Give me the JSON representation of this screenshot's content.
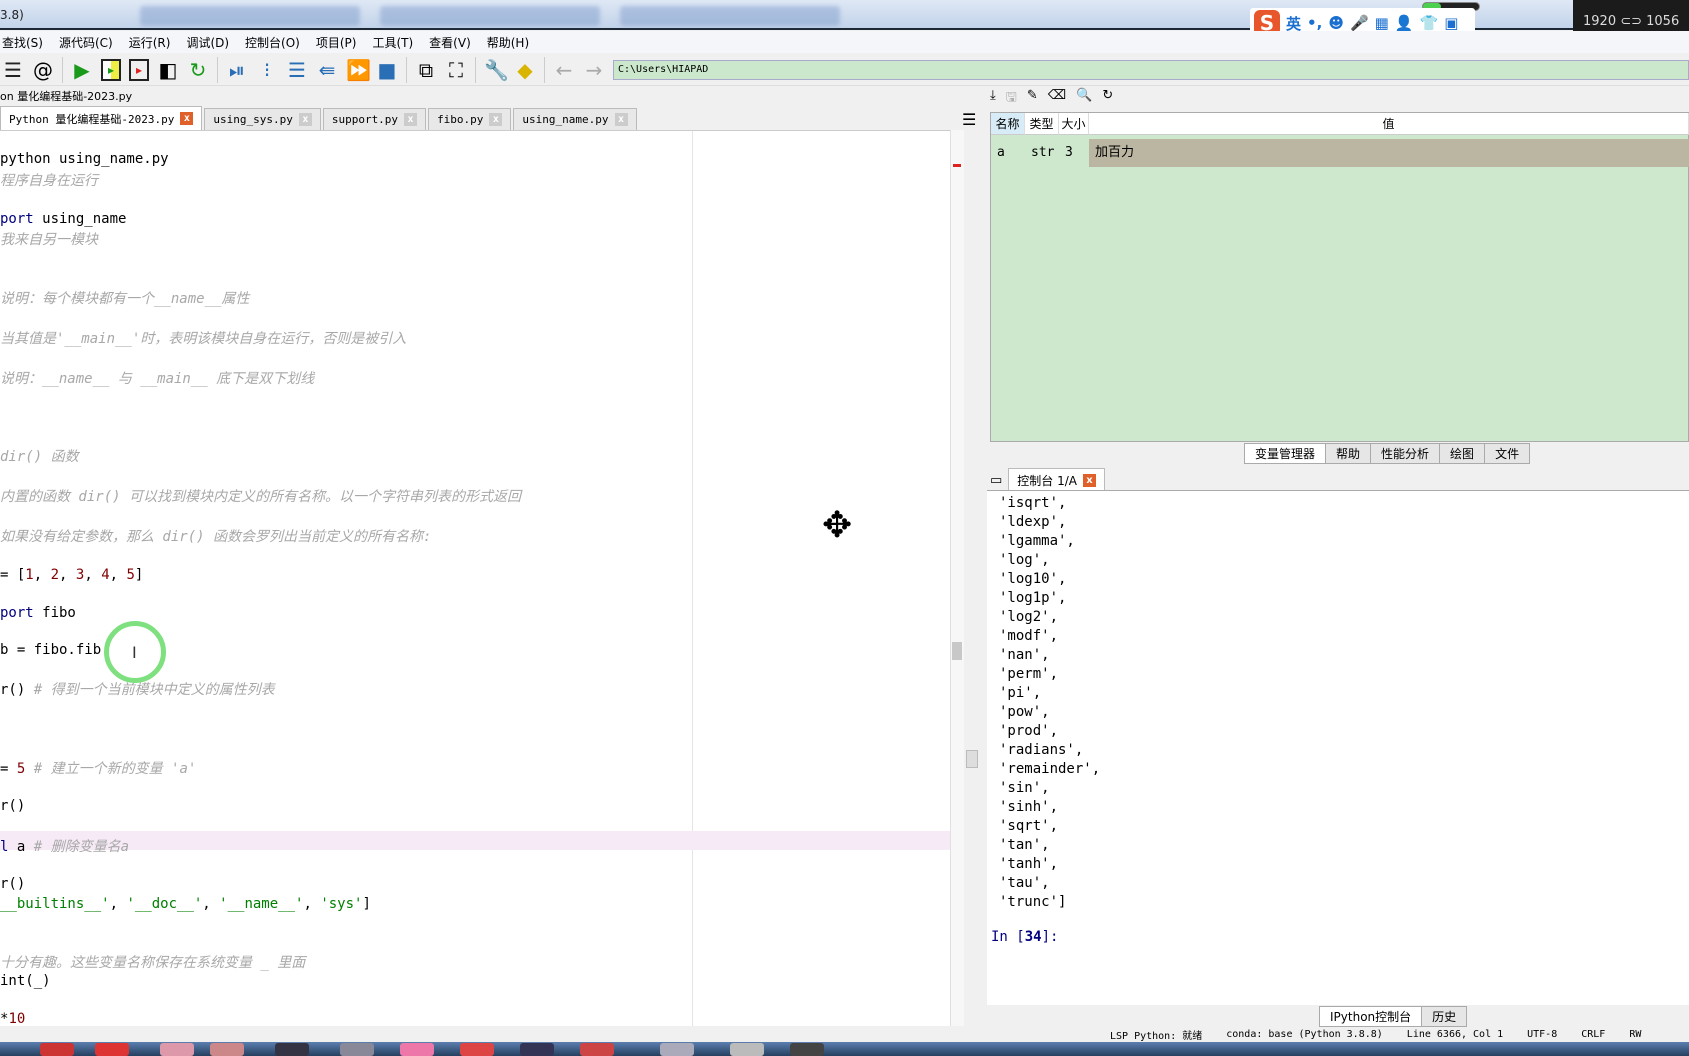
{
  "window": {
    "title": "3.8)"
  },
  "ime": {
    "logo": "S",
    "items": [
      "英",
      "•,",
      "☻",
      "🎤",
      "▦",
      "👤",
      "👕",
      "▣"
    ]
  },
  "screen_resolution": "1920 ⊂⊃ 1056",
  "menu": [
    "查找(S)",
    "源代码(C)",
    "运行(R)",
    "调试(D)",
    "控制台(O)",
    "项目(P)",
    "工具(T)",
    "查看(V)",
    "帮助(H)"
  ],
  "toolbar": {
    "icons": [
      "list-icon",
      "at-icon",
      "run-icon",
      "run-cell-icon",
      "run-cell-advance-icon",
      "run-selection-icon",
      "rerun-icon",
      "debug-icon",
      "step-icon",
      "step-into-icon",
      "step-return-icon",
      "continue-icon",
      "stop-icon",
      "maximize-pane-icon",
      "fullscreen-icon",
      "wrench-icon",
      "python-path-icon",
      "back-icon",
      "forward-icon"
    ],
    "path": "C:\\Users\\HIAPAD"
  },
  "file_label": "on 量化编程基础-2023.py",
  "tabs": [
    {
      "label": "Python 量化编程基础-2023.py",
      "active": true
    },
    {
      "label": "using_sys.py"
    },
    {
      "label": "support.py"
    },
    {
      "label": "fibo.py"
    },
    {
      "label": "using_name.py"
    }
  ],
  "editor": {
    "lines": [
      [
        [
          "python using_name.py",
          ""
        ]
      ],
      [
        [
          "程序自身在运行",
          "cm"
        ]
      ],
      [
        [
          "port",
          "kw"
        ],
        [
          " using_name",
          ""
        ]
      ],
      [
        [
          "我来自另一模块",
          "cm"
        ]
      ],
      [
        [
          "说明：每个模块都有一个__name__属性",
          "cm"
        ]
      ],
      [
        [
          "当其值是'__main__'时，表明该模块自身在运行，否则是被引入",
          "cm"
        ]
      ],
      [
        [
          "说明：__name__ 与 __main__ 底下是双下划线",
          "cm"
        ]
      ],
      [
        [
          "dir() 函数",
          "cm"
        ]
      ],
      [
        [
          "内置的函数 dir() 可以找到模块内定义的所有名称。以一个字符串列表的形式返回",
          "cm"
        ]
      ],
      [
        [
          "如果没有给定参数，那么 dir() 函数会罗列出当前定义的所有名称:",
          "cm"
        ]
      ],
      [
        [
          "= [",
          ""
        ],
        [
          "1",
          "nm"
        ],
        [
          ", ",
          ""
        ],
        [
          "2",
          "nm"
        ],
        [
          ", ",
          ""
        ],
        [
          "3",
          "nm"
        ],
        [
          ", ",
          ""
        ],
        [
          "4",
          "nm"
        ],
        [
          ", ",
          ""
        ],
        [
          "5",
          "nm"
        ],
        [
          "]",
          ""
        ]
      ],
      [
        [
          "port",
          "kw"
        ],
        [
          " fibo",
          ""
        ]
      ],
      [
        [
          "b = fibo.fib",
          ""
        ]
      ],
      [
        [
          "r() ",
          ""
        ],
        [
          "# 得到一个当前模块中定义的属性列表",
          "cm"
        ]
      ],
      [
        [
          "= ",
          ""
        ],
        [
          "5",
          "nm"
        ],
        [
          " # 建立一个新的变量 'a'",
          "cm"
        ]
      ],
      [
        [
          "r()",
          ""
        ]
      ],
      [
        [
          "l",
          "kw"
        ],
        [
          " a ",
          ""
        ],
        [
          "# 删除变量名a",
          "cm"
        ]
      ],
      [
        [
          "r()",
          ""
        ]
      ],
      [
        [
          "__builtins__'",
          "st"
        ],
        [
          ", ",
          ""
        ],
        [
          "'__doc__'",
          "st"
        ],
        [
          ", ",
          ""
        ],
        [
          "'__name__'",
          "st"
        ],
        [
          ", ",
          ""
        ],
        [
          "'sys'",
          "st"
        ],
        [
          "]",
          ""
        ]
      ],
      [
        [
          "十分有趣。这些变量名称保存在系统变量 _ 里面",
          "cm"
        ]
      ],
      [
        [
          "int(_)",
          ""
        ]
      ],
      [
        [
          "*",
          ""
        ],
        [
          "10",
          "nm"
        ]
      ]
    ]
  },
  "variable_explorer": {
    "columns": [
      "名称",
      "类型",
      "大小",
      "值"
    ],
    "rows": [
      {
        "name": "a",
        "type": "str",
        "size": "3",
        "value": "加百力"
      }
    ]
  },
  "panel_tabs": [
    "变量管理器",
    "帮助",
    "性能分析",
    "绘图",
    "文件"
  ],
  "console": {
    "tab": "控制台 1/A",
    "lines": [
      "'isqrt',",
      "'ldexp',",
      "'lgamma',",
      "'log',",
      "'log10',",
      "'log1p',",
      "'log2',",
      "'modf',",
      "'nan',",
      "'perm',",
      "'pi',",
      "'pow',",
      "'prod',",
      "'radians',",
      "'remainder',",
      "'sin',",
      "'sinh',",
      "'sqrt',",
      "'tan',",
      "'tanh',",
      "'tau',",
      "'trunc']"
    ],
    "prompt_prefix": "In [",
    "prompt_num": "34",
    "prompt_suffix": "]:"
  },
  "bottom_tabs": [
    "IPython控制台",
    "历史"
  ],
  "status": {
    "lsp": "LSP Python: 就绪",
    "conda": "conda: base (Python 3.8.8)",
    "position": "Line 6366, Col 1",
    "encoding": "UTF-8",
    "eol": "CRLF",
    "mode": "RW"
  }
}
